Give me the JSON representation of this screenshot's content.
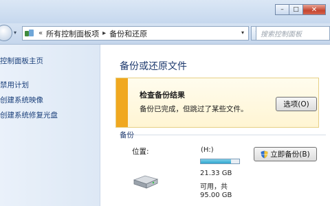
{
  "window": {
    "minimize_glyph": "–",
    "maximize_glyph": "□",
    "close_glyph": "✕"
  },
  "address": {
    "prefix": "«",
    "crumbs": [
      "所有控制面板项",
      "备份和还原"
    ],
    "separator": "▸",
    "dropdown_glyph": "▾",
    "refresh_glyph": "↻",
    "search_placeholder": "搜索控制面板"
  },
  "sidebar": {
    "items": [
      {
        "label": "控制面板主页"
      },
      {
        "label": "禁用计划"
      },
      {
        "label": "创建系统映像"
      },
      {
        "label": "创建系统修复光盘"
      }
    ]
  },
  "main": {
    "title": "备份或还原文件",
    "notice": {
      "heading": "检查备份结果",
      "text": "备份已完成，但跳过了某些文件。",
      "button": "选项(O)",
      "accent_color": "#f0a820"
    },
    "backup": {
      "section_label": "备份",
      "location_label": "位置:",
      "drive": "(H:)",
      "used_fraction": 0.78,
      "free": "21.33 GB",
      "available_of": "可用，共",
      "total": "95.00 GB",
      "button": "立即备份(B)",
      "icons": [
        "drive-icon",
        "shield-icon"
      ]
    }
  }
}
